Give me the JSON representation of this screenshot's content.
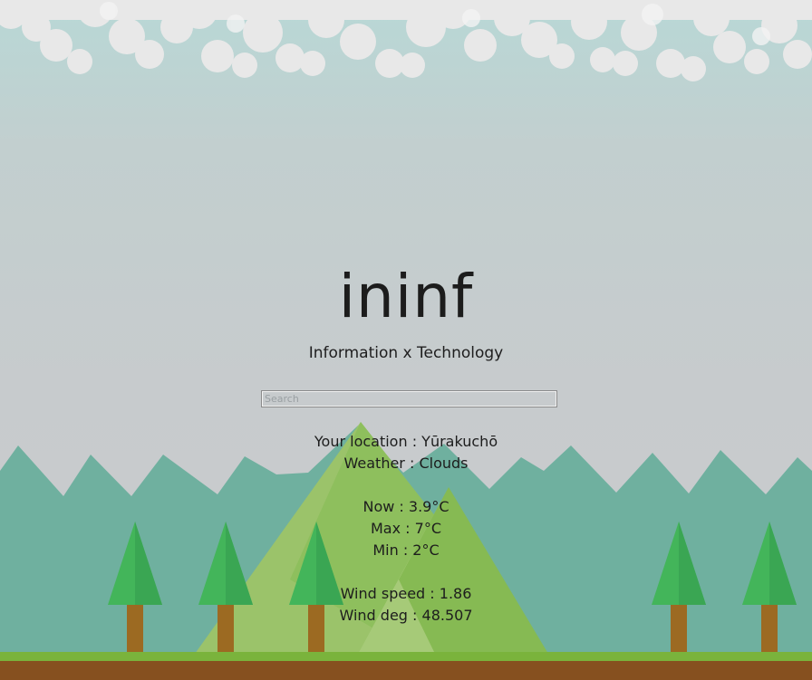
{
  "header": {
    "title": "ininf",
    "subtitle": "Information x Technology"
  },
  "search": {
    "placeholder": "Search",
    "value": ""
  },
  "weather": {
    "location": "Your location : Yūrakuchō",
    "condition": "Weather : Clouds",
    "now": "Now : 3.9°C",
    "max": "Max : 7°C",
    "min": "Min : 2°C",
    "wind_speed": "Wind speed : 1.86",
    "wind_deg": "Wind deg : 48.507"
  },
  "colors": {
    "sky_top": "#b8d8d6",
    "sky_bottom": "#c9cbcd",
    "cloud": "#e9e9e9",
    "back_mountains": "#6fb09f",
    "front_mountain_light": "#9bc36a",
    "front_mountain_dark": "#82b84e",
    "tree_foliage": "#43b55a",
    "tree_trunk": "#9c6a22",
    "grass": "#7ab33c",
    "soil": "#86501f"
  },
  "icons": {
    "clouds": "cloud-band-icon",
    "mountains": "mountain-range-icon",
    "trees": "pine-tree-icon"
  }
}
